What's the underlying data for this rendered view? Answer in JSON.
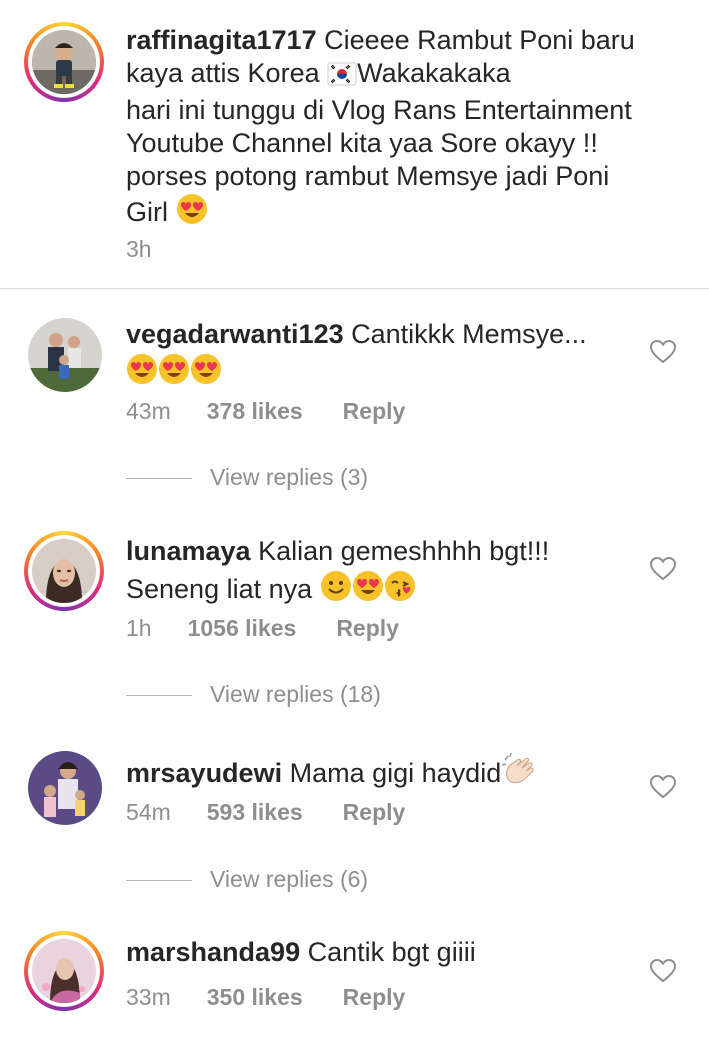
{
  "caption": {
    "username": "raffinagita1717",
    "lines": [
      "Cieeee Rambut Poni baru",
      "kaya attis Korea",
      "Wakakakaka",
      "hari ini tunggu di Vlog Rans Entertainment",
      "Youtube Channel kita yaa Sore okayy !!",
      "porses potong rambut Memsye jadi Poni",
      "Girl"
    ],
    "time": "3h"
  },
  "comments": [
    {
      "username": "vegadarwanti123",
      "text": "Cantikkk Memsye...",
      "time": "43m",
      "likes": "378 likes",
      "reply": "Reply",
      "view_replies": "View replies (3)"
    },
    {
      "username": "lunamaya",
      "text": "Kalian gemeshhhh bgt!!!",
      "text2": "Seneng liat nya",
      "time": "1h",
      "likes": "1056 likes",
      "reply": "Reply",
      "view_replies": "View replies (18)"
    },
    {
      "username": "mrsayudewi",
      "text": "Mama gigi haydid",
      "time": "54m",
      "likes": "593 likes",
      "reply": "Reply",
      "view_replies": "View replies (6)"
    },
    {
      "username": "marshanda99",
      "text": "Cantik bgt giiii",
      "time": "33m",
      "likes": "350 likes",
      "reply": "Reply"
    }
  ],
  "icons": [
    "heart-eyes-emoji",
    "korea-flag-emoji",
    "smile-emoji",
    "kiss-emoji",
    "clapping-emoji",
    "heart-outline-icon"
  ],
  "colors": {
    "text": "#262626",
    "secondary": "#8e8e8e",
    "divider": "#dbdbdb"
  }
}
